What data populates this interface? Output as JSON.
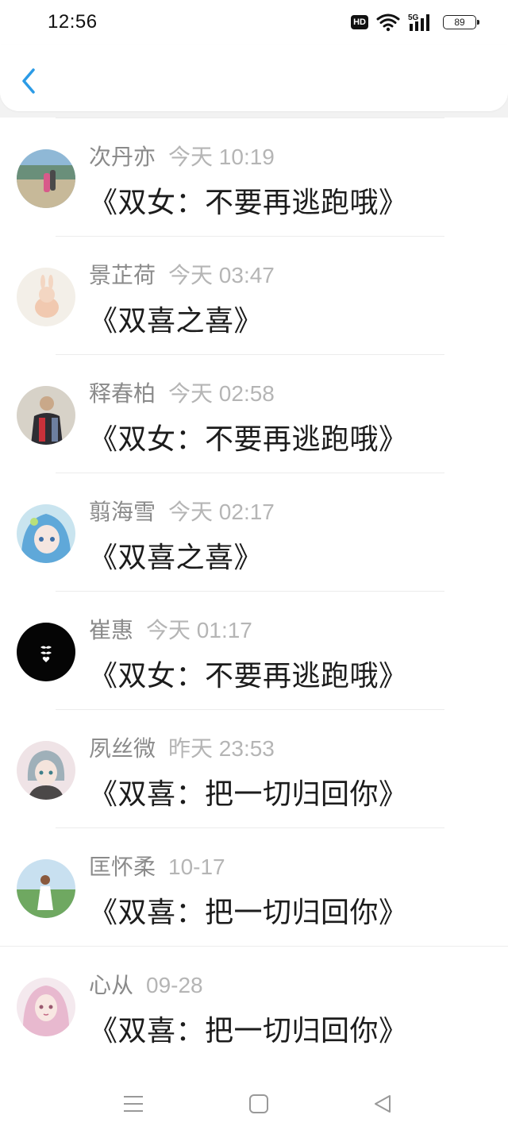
{
  "status_bar": {
    "time": "12:56",
    "hd_label": "HD",
    "signal_label": "5G",
    "battery": "89"
  },
  "header": {
    "back_icon": "chevron-left-icon",
    "accent_color": "#2b9be6"
  },
  "items": [
    {
      "name": "次丹亦",
      "time": "今天 10:19",
      "message": "《双女：不要再逃跑哦》"
    },
    {
      "name": "景芷荷",
      "time": "今天 03:47",
      "message": "《双喜之喜》"
    },
    {
      "name": "释春柏",
      "time": "今天 02:58",
      "message": "《双女：不要再逃跑哦》"
    },
    {
      "name": "翦海雪",
      "time": "今天 02:17",
      "message": "《双喜之喜》"
    },
    {
      "name": "崔惠",
      "time": "今天 01:17",
      "message": "《双女：不要再逃跑哦》"
    },
    {
      "name": "夙丝微",
      "time": "昨天 23:53",
      "message": "《双喜：把一切归回你》"
    },
    {
      "name": "匡怀柔",
      "time": "10-17",
      "message": "《双喜：把一切归回你》"
    },
    {
      "name": "心从",
      "time": "09-28",
      "message": "《双喜：把一切归回你》"
    }
  ],
  "nav": {
    "menu_icon": "menu-icon",
    "home_icon": "home-square-icon",
    "back_icon": "back-triangle-icon"
  }
}
